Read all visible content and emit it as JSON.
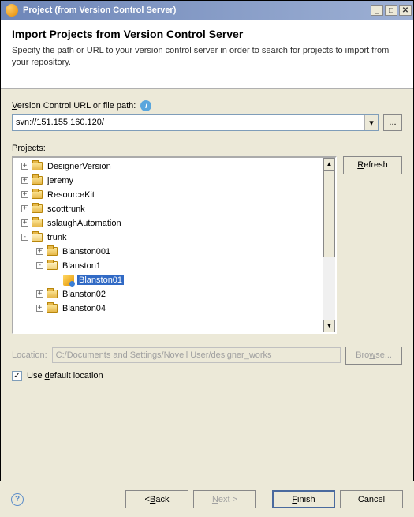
{
  "window": {
    "title": "Project (from Version Control Server)"
  },
  "banner": {
    "heading": "Import Projects from Version Control Server",
    "description": "Specify the path or URL to your version control server in order to search for projects to import from your repository."
  },
  "url_field": {
    "label_pre": "",
    "label_key": "V",
    "label_post": "ersion Control URL or file path:",
    "value": "svn://151.155.160.120/",
    "browse": "..."
  },
  "projects_label_pre": "",
  "projects_label_key": "P",
  "projects_label_post": "rojects:",
  "refresh_pre": "",
  "refresh_key": "R",
  "refresh_post": "efresh",
  "tree": [
    {
      "indent": 0,
      "expander": "+",
      "icon": "folder",
      "label": "DesignerVersion",
      "selected": false
    },
    {
      "indent": 0,
      "expander": "+",
      "icon": "folder",
      "label": "jeremy",
      "selected": false
    },
    {
      "indent": 0,
      "expander": "+",
      "icon": "folder",
      "label": "ResourceKit",
      "selected": false
    },
    {
      "indent": 0,
      "expander": "+",
      "icon": "folder",
      "label": "scotttrunk",
      "selected": false
    },
    {
      "indent": 0,
      "expander": "+",
      "icon": "folder",
      "label": "sslaughAutomation",
      "selected": false
    },
    {
      "indent": 0,
      "expander": "-",
      "icon": "folder-open",
      "label": "trunk",
      "selected": false
    },
    {
      "indent": 1,
      "expander": "+",
      "icon": "folder",
      "label": "Blanston001",
      "selected": false
    },
    {
      "indent": 1,
      "expander": "-",
      "icon": "folder-open",
      "label": "Blanston1",
      "selected": false
    },
    {
      "indent": 2,
      "expander": "",
      "icon": "project",
      "label": "Blanston01",
      "selected": true
    },
    {
      "indent": 1,
      "expander": "+",
      "icon": "folder",
      "label": "Blanston02",
      "selected": false
    },
    {
      "indent": 1,
      "expander": "+",
      "icon": "folder",
      "label": "Blanston04",
      "selected": false
    }
  ],
  "location": {
    "label": "Location:",
    "value": "C:/Documents and Settings/Novell User/designer_works",
    "browse_pre": "Bro",
    "browse_key": "w",
    "browse_post": "se..."
  },
  "default_loc": {
    "pre": "Use ",
    "key": "d",
    "post": "efault location",
    "checked": "✓"
  },
  "footer": {
    "back": "< Back",
    "next": "Next >",
    "finish": "Finish",
    "cancel": "Cancel",
    "back_key": "B",
    "next_key": "N",
    "finish_key": "F"
  }
}
